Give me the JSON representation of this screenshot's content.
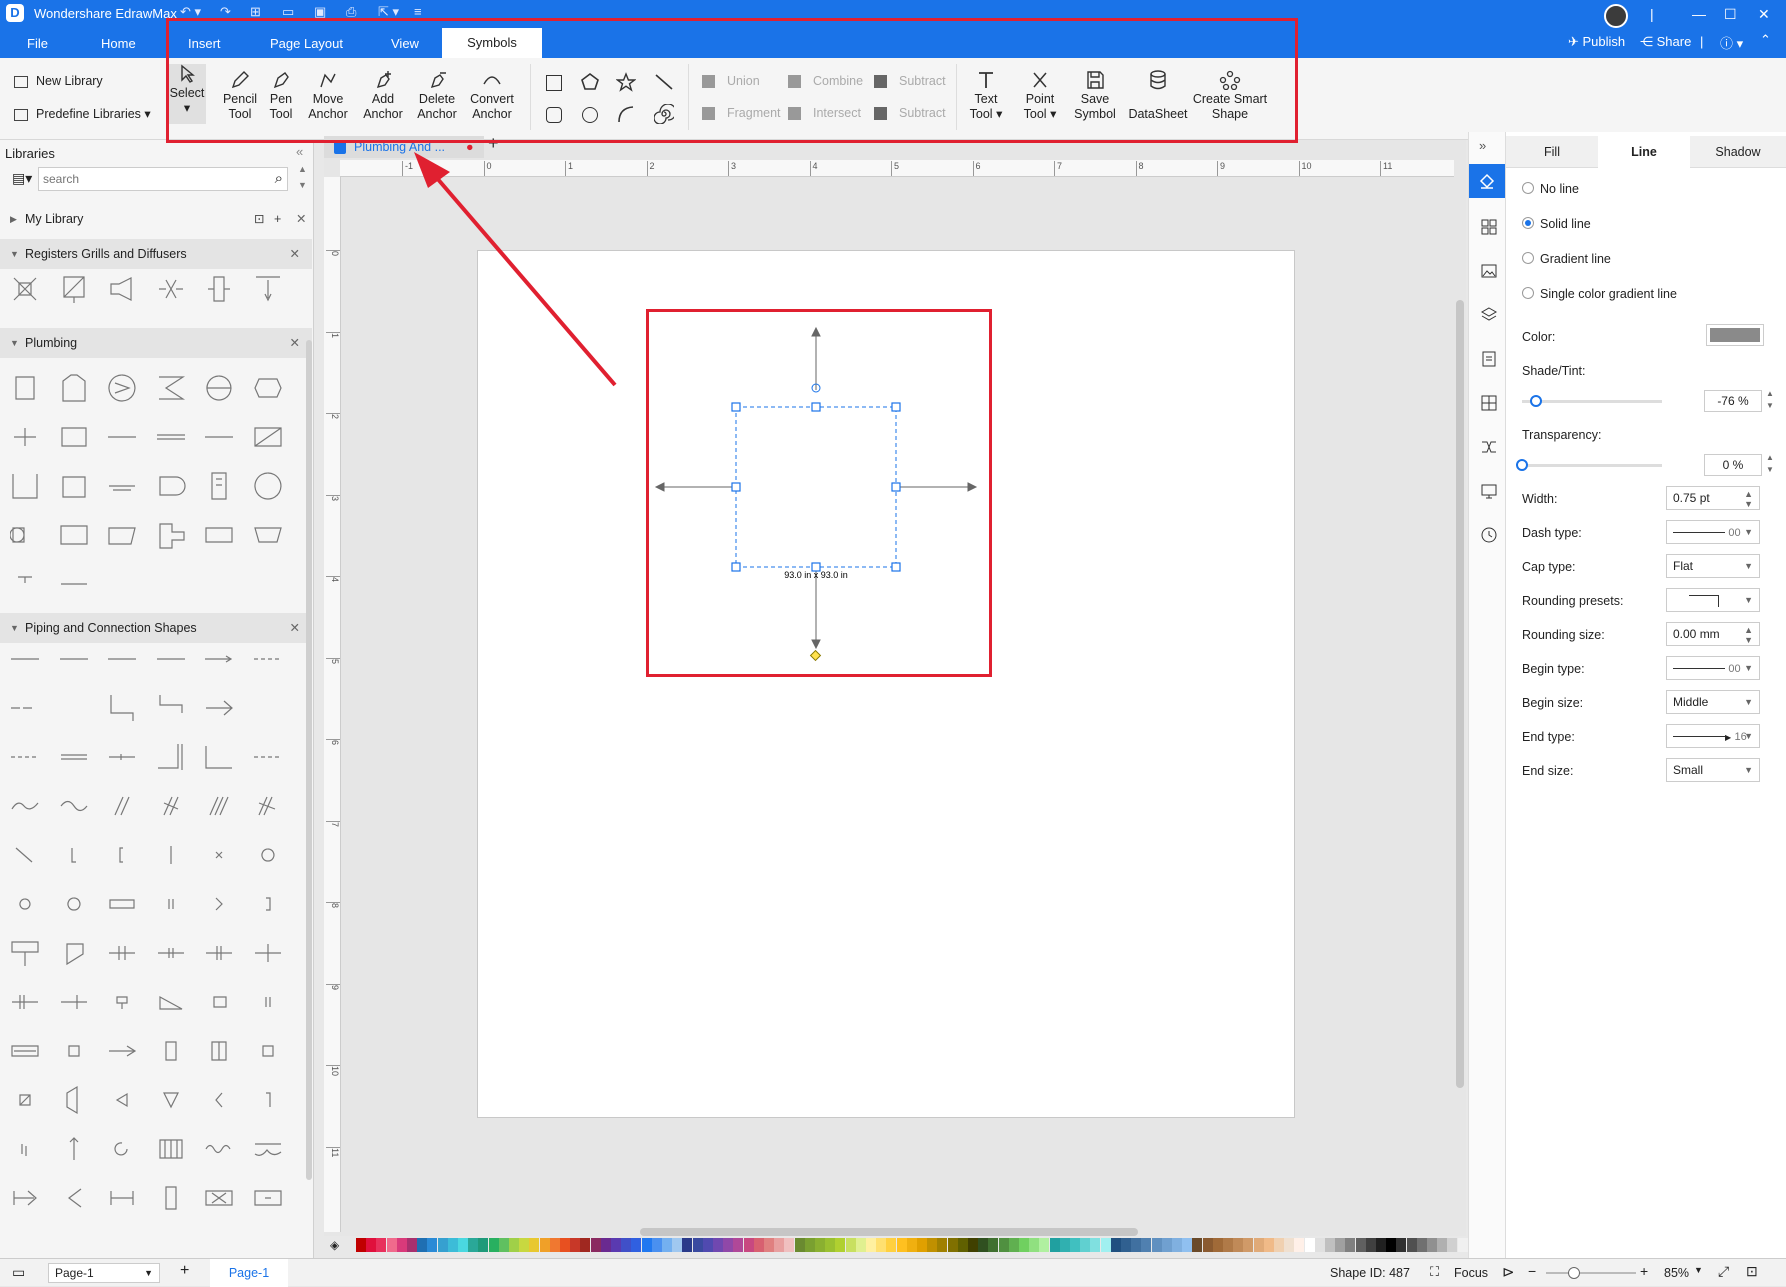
{
  "app": {
    "title": "Wondershare EdrawMax"
  },
  "menu": {
    "tabs": [
      "File",
      "Home",
      "Insert",
      "Page Layout",
      "View",
      "Symbols"
    ],
    "active": "Symbols"
  },
  "topright": {
    "publish": "Publish",
    "share": "Share"
  },
  "ribbon": {
    "new_library": "New Library",
    "predefine_libraries": "Predefine Libraries",
    "select": "Select",
    "pencil_tool": [
      "Pencil",
      "Tool"
    ],
    "pen_tool": [
      "Pen",
      "Tool"
    ],
    "move_anchor": [
      "Move",
      "Anchor"
    ],
    "add_anchor": [
      "Add",
      "Anchor"
    ],
    "delete_anchor": [
      "Delete",
      "Anchor"
    ],
    "convert_anchor": [
      "Convert",
      "Anchor"
    ],
    "union": "Union",
    "combine": "Combine",
    "subtract": "Subtract",
    "fragment": "Fragment",
    "intersect": "Intersect",
    "subtract2": "Subtract",
    "text_tool": [
      "Text",
      "Tool"
    ],
    "point_tool": [
      "Point",
      "Tool"
    ],
    "save_symbol": [
      "Save",
      "Symbol"
    ],
    "datasheet": "DataSheet",
    "create_smart_shape": [
      "Create Smart",
      "Shape"
    ]
  },
  "left": {
    "libraries_title": "Libraries",
    "search_placeholder": "search",
    "my_library": "My Library",
    "sections": [
      "Registers Grills and Diffusers",
      "Plumbing",
      "Piping and Connection Shapes"
    ]
  },
  "document": {
    "tab_label": "Plumbing And ...",
    "size_label": "93.0 in x 93.0 in"
  },
  "ruler": {
    "h_ticks": [
      "-1",
      "0",
      "1",
      "2",
      "3",
      "4",
      "5",
      "6",
      "7",
      "8",
      "9",
      "10",
      "11"
    ],
    "v_ticks": [
      "0",
      "1",
      "2",
      "3",
      "4",
      "5",
      "6",
      "7",
      "8",
      "9",
      "10",
      "11"
    ]
  },
  "right": {
    "tabs": [
      "Fill",
      "Line",
      "Shadow"
    ],
    "active_tab": "Line",
    "line_options": [
      "No line",
      "Solid line",
      "Gradient line",
      "Single color gradient line"
    ],
    "selected_line": "Solid line",
    "color_label": "Color:",
    "line_color": "#8a8a8a",
    "shade_label": "Shade/Tint:",
    "shade_value": "-76 %",
    "shade_fraction": 0.1,
    "transparency_label": "Transparency:",
    "transparency_value": "0 %",
    "transparency_fraction": 0.0,
    "width_label": "Width:",
    "width_value": "0.75 pt",
    "dash_label": "Dash type:",
    "dash_value": "00",
    "cap_label": "Cap type:",
    "cap_value": "Flat",
    "rounding_presets_label": "Rounding presets:",
    "rounding_size_label": "Rounding size:",
    "rounding_size_value": "0.00 mm",
    "begin_type_label": "Begin type:",
    "begin_type_value": "00",
    "begin_size_label": "Begin size:",
    "begin_size_value": "Middle",
    "end_type_label": "End type:",
    "end_type_value": "16",
    "end_size_label": "End size:",
    "end_size_value": "Small"
  },
  "status": {
    "page_select": "Page-1",
    "page_tab": "Page-1",
    "shape_id": "Shape ID: 487",
    "focus": "Focus",
    "zoom": "85%"
  },
  "colors": {
    "accent": "#1a73e8",
    "highlight": "#e02030"
  }
}
